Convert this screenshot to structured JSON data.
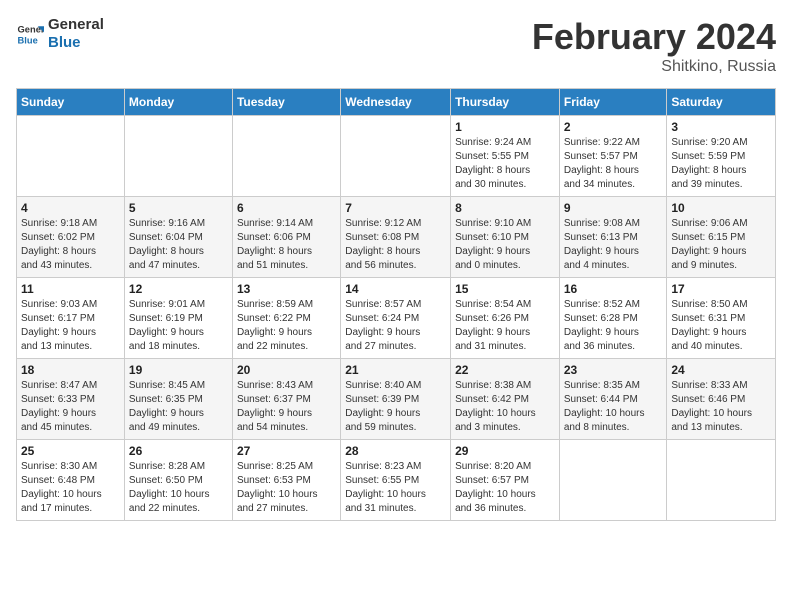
{
  "header": {
    "logo_line1": "General",
    "logo_line2": "Blue",
    "month_year": "February 2024",
    "location": "Shitkino, Russia"
  },
  "weekdays": [
    "Sunday",
    "Monday",
    "Tuesday",
    "Wednesday",
    "Thursday",
    "Friday",
    "Saturday"
  ],
  "weeks": [
    [
      {
        "day": "",
        "info": ""
      },
      {
        "day": "",
        "info": ""
      },
      {
        "day": "",
        "info": ""
      },
      {
        "day": "",
        "info": ""
      },
      {
        "day": "1",
        "info": "Sunrise: 9:24 AM\nSunset: 5:55 PM\nDaylight: 8 hours\nand 30 minutes."
      },
      {
        "day": "2",
        "info": "Sunrise: 9:22 AM\nSunset: 5:57 PM\nDaylight: 8 hours\nand 34 minutes."
      },
      {
        "day": "3",
        "info": "Sunrise: 9:20 AM\nSunset: 5:59 PM\nDaylight: 8 hours\nand 39 minutes."
      }
    ],
    [
      {
        "day": "4",
        "info": "Sunrise: 9:18 AM\nSunset: 6:02 PM\nDaylight: 8 hours\nand 43 minutes."
      },
      {
        "day": "5",
        "info": "Sunrise: 9:16 AM\nSunset: 6:04 PM\nDaylight: 8 hours\nand 47 minutes."
      },
      {
        "day": "6",
        "info": "Sunrise: 9:14 AM\nSunset: 6:06 PM\nDaylight: 8 hours\nand 51 minutes."
      },
      {
        "day": "7",
        "info": "Sunrise: 9:12 AM\nSunset: 6:08 PM\nDaylight: 8 hours\nand 56 minutes."
      },
      {
        "day": "8",
        "info": "Sunrise: 9:10 AM\nSunset: 6:10 PM\nDaylight: 9 hours\nand 0 minutes."
      },
      {
        "day": "9",
        "info": "Sunrise: 9:08 AM\nSunset: 6:13 PM\nDaylight: 9 hours\nand 4 minutes."
      },
      {
        "day": "10",
        "info": "Sunrise: 9:06 AM\nSunset: 6:15 PM\nDaylight: 9 hours\nand 9 minutes."
      }
    ],
    [
      {
        "day": "11",
        "info": "Sunrise: 9:03 AM\nSunset: 6:17 PM\nDaylight: 9 hours\nand 13 minutes."
      },
      {
        "day": "12",
        "info": "Sunrise: 9:01 AM\nSunset: 6:19 PM\nDaylight: 9 hours\nand 18 minutes."
      },
      {
        "day": "13",
        "info": "Sunrise: 8:59 AM\nSunset: 6:22 PM\nDaylight: 9 hours\nand 22 minutes."
      },
      {
        "day": "14",
        "info": "Sunrise: 8:57 AM\nSunset: 6:24 PM\nDaylight: 9 hours\nand 27 minutes."
      },
      {
        "day": "15",
        "info": "Sunrise: 8:54 AM\nSunset: 6:26 PM\nDaylight: 9 hours\nand 31 minutes."
      },
      {
        "day": "16",
        "info": "Sunrise: 8:52 AM\nSunset: 6:28 PM\nDaylight: 9 hours\nand 36 minutes."
      },
      {
        "day": "17",
        "info": "Sunrise: 8:50 AM\nSunset: 6:31 PM\nDaylight: 9 hours\nand 40 minutes."
      }
    ],
    [
      {
        "day": "18",
        "info": "Sunrise: 8:47 AM\nSunset: 6:33 PM\nDaylight: 9 hours\nand 45 minutes."
      },
      {
        "day": "19",
        "info": "Sunrise: 8:45 AM\nSunset: 6:35 PM\nDaylight: 9 hours\nand 49 minutes."
      },
      {
        "day": "20",
        "info": "Sunrise: 8:43 AM\nSunset: 6:37 PM\nDaylight: 9 hours\nand 54 minutes."
      },
      {
        "day": "21",
        "info": "Sunrise: 8:40 AM\nSunset: 6:39 PM\nDaylight: 9 hours\nand 59 minutes."
      },
      {
        "day": "22",
        "info": "Sunrise: 8:38 AM\nSunset: 6:42 PM\nDaylight: 10 hours\nand 3 minutes."
      },
      {
        "day": "23",
        "info": "Sunrise: 8:35 AM\nSunset: 6:44 PM\nDaylight: 10 hours\nand 8 minutes."
      },
      {
        "day": "24",
        "info": "Sunrise: 8:33 AM\nSunset: 6:46 PM\nDaylight: 10 hours\nand 13 minutes."
      }
    ],
    [
      {
        "day": "25",
        "info": "Sunrise: 8:30 AM\nSunset: 6:48 PM\nDaylight: 10 hours\nand 17 minutes."
      },
      {
        "day": "26",
        "info": "Sunrise: 8:28 AM\nSunset: 6:50 PM\nDaylight: 10 hours\nand 22 minutes."
      },
      {
        "day": "27",
        "info": "Sunrise: 8:25 AM\nSunset: 6:53 PM\nDaylight: 10 hours\nand 27 minutes."
      },
      {
        "day": "28",
        "info": "Sunrise: 8:23 AM\nSunset: 6:55 PM\nDaylight: 10 hours\nand 31 minutes."
      },
      {
        "day": "29",
        "info": "Sunrise: 8:20 AM\nSunset: 6:57 PM\nDaylight: 10 hours\nand 36 minutes."
      },
      {
        "day": "",
        "info": ""
      },
      {
        "day": "",
        "info": ""
      }
    ]
  ]
}
